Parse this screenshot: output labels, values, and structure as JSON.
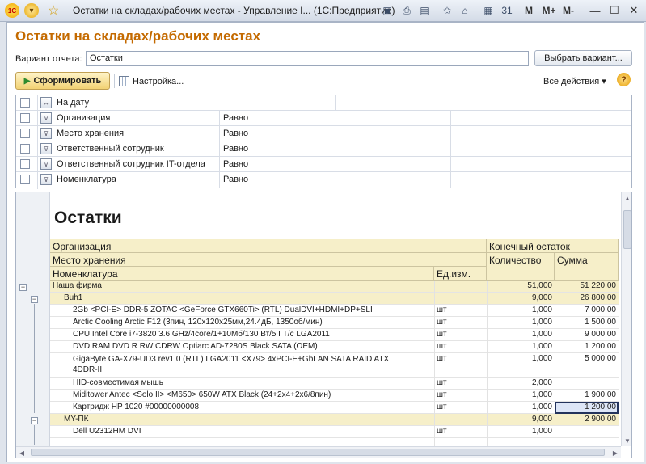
{
  "window": {
    "title": "Остатки на складах/рабочих местах - Управление I...  (1С:Предприятие)",
    "toolbar_right": [
      "M",
      "M+",
      "M-"
    ]
  },
  "form": {
    "title": "Остатки на складах/рабочих местах",
    "variant_label": "Вариант отчета:",
    "variant_value": "Остатки",
    "choose_variant_button": "Выбрать вариант...",
    "generate_button": "Сформировать",
    "settings_link": "Настройка...",
    "all_actions": "Все действия ▾",
    "help": "?"
  },
  "filters": [
    {
      "name": "На дату",
      "condition": ""
    },
    {
      "name": "Организация",
      "condition": "Равно"
    },
    {
      "name": "Место хранения",
      "condition": "Равно"
    },
    {
      "name": "Ответственный сотрудник",
      "condition": "Равно"
    },
    {
      "name": "Ответственный сотрудник IT-отдела",
      "condition": "Равно"
    },
    {
      "name": "Номенклатура",
      "condition": "Равно"
    }
  ],
  "report": {
    "title": "Остатки",
    "headers": {
      "org": "Организация",
      "storage": "Место хранения",
      "item": "Номенклатура",
      "unit": "Ед.изм.",
      "end_balance": "Конечный остаток",
      "qty": "Количество",
      "sum": "Сумма"
    },
    "rows": [
      {
        "kind": "firm",
        "name": "Наша фирма",
        "unit": "",
        "qty": "51,000",
        "sum": "51 220,00"
      },
      {
        "kind": "group",
        "name": "Buh1",
        "unit": "",
        "qty": "9,000",
        "sum": "26 800,00"
      },
      {
        "kind": "item",
        "name": "2Gb <PCI-E> DDR-5 ZOTAC <GeForce GTX660Ti> (RTL) DualDVI+HDMI+DP+SLI",
        "unit": "шт",
        "qty": "1,000",
        "sum": "7 000,00"
      },
      {
        "kind": "item",
        "name": "Arctic Cooling Arctic F12 (3пин, 120x120x25мм,24.4дБ, 1350об/мин)",
        "unit": "шт",
        "qty": "1,000",
        "sum": "1 500,00"
      },
      {
        "kind": "item",
        "name": "CPU Intel Core i7-3820 3.6 GHz/4core/1+10Mб/130 Вт/5 ГТ/с LGA2011",
        "unit": "шт",
        "qty": "1,000",
        "sum": "9 000,00"
      },
      {
        "kind": "item",
        "name": "DVD RAM DVD R RW  CDRW Optiarc AD-7280S Black SATA (OEM)",
        "unit": "шт",
        "qty": "1,000",
        "sum": "1 200,00"
      },
      {
        "kind": "item2",
        "name": "GigaByte GA-X79-UD3 rev1.0 (RTL) LGA2011 <X79> 4xPCI-E+GbLAN SATA RAID ATX",
        "name2": "4DDR-III",
        "unit": "шт",
        "qty": "1,000",
        "sum": "5 000,00"
      },
      {
        "kind": "item",
        "name": "HID-совместимая мышь",
        "unit": "шт",
        "qty": "2,000",
        "sum": ""
      },
      {
        "kind": "item",
        "name": "Miditower Antec <Solo II> <M650> 650W ATX Black (24+2x4+2x6/8пин)",
        "unit": "шт",
        "qty": "1,000",
        "sum": "1 900,00"
      },
      {
        "kind": "item",
        "name": "Картридж HP 1020 #00000000008",
        "unit": "шт",
        "qty": "1,000",
        "sum": "1 200,00",
        "selected": true
      },
      {
        "kind": "group",
        "name": "MY-ПК",
        "unit": "",
        "qty": "9,000",
        "sum": "2 900,00"
      },
      {
        "kind": "item",
        "name": "Dell U2312HM DVI",
        "unit": "шт",
        "qty": "1,000",
        "sum": ""
      }
    ]
  }
}
